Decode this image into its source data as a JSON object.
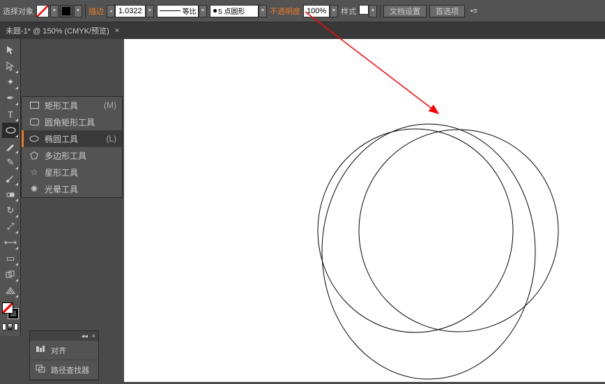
{
  "topbar": {
    "select_target_label": "选择对象",
    "stroke_label": "描边",
    "stroke_weight": "1.0322",
    "stroke_dash_label": "等比",
    "brush_label": "5 点圆形",
    "opacity_label": "不透明度",
    "opacity_value": "100%",
    "style_label": "样式",
    "doc_setup_label": "文档设置",
    "prefs_label": "首选项"
  },
  "doctab": {
    "title": "未题-1* @ 150% (CMYK/预览)",
    "close": "×"
  },
  "flyout": {
    "items": [
      {
        "label": "矩形工具",
        "shortcut": "(M)"
      },
      {
        "label": "圆角矩形工具",
        "shortcut": ""
      },
      {
        "label": "椭圆工具",
        "shortcut": "(L)"
      },
      {
        "label": "多边形工具",
        "shortcut": ""
      },
      {
        "label": "星形工具",
        "shortcut": ""
      },
      {
        "label": "光晕工具",
        "shortcut": ""
      }
    ]
  },
  "panel": {
    "align_label": "对齐",
    "pathfinder_label": "路径查找器"
  }
}
